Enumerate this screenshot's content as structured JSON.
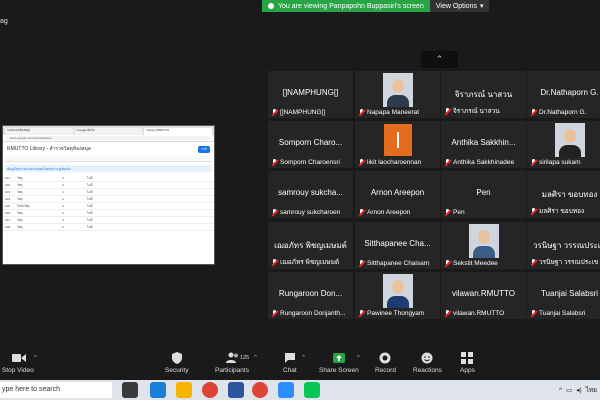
{
  "banner": {
    "viewing_text": "You are viewing Panpapohn Buppasiri's screen",
    "view_options_label": "View Options"
  },
  "top_left_text": "ag",
  "shared_screen": {
    "tabs": [
      "ระบบงานห้องสมุด",
      "Google ฟอร์ม",
      "Library RMUTTO"
    ],
    "url": "docs.google.com/spreadsheets",
    "doc_title": "RMUTTO Library - สำรวจวัสดุห้องสมุด",
    "share_label": "แชร์",
    "notice": "ข้อมูลไฟล์บางส่วนอาจแสดงไม่ครบถ้วน ดูเพิ่มเติม",
    "rows": [
      [
        "101",
        "วัสดุ",
        "4",
        "ไม่มี"
      ],
      [
        "102",
        "วัสดุ",
        "4",
        "ไม่มี"
      ],
      [
        "103",
        "วัสดุ",
        "4",
        "ไม่มี"
      ],
      [
        "104",
        "วัสดุ",
        "4",
        "ไม่มี"
      ],
      [
        "105",
        "ใบรับวัสดุ",
        "4",
        "ไม่มี"
      ],
      [
        "106",
        "วัสดุ",
        "4",
        "ไม่มี"
      ],
      [
        "107",
        "วัสดุ",
        "4",
        "ไม่มี"
      ],
      [
        "108",
        "วัสดุ",
        "4",
        "ไม่มี"
      ]
    ]
  },
  "participants": [
    {
      "big": "[]NAMPHUNG[]",
      "name": "[]NAMPHUNG[]",
      "kind": "name"
    },
    {
      "big": "",
      "name": "Napapa Maneerat",
      "kind": "photo",
      "body": "#2e3b4f"
    },
    {
      "big": "จิราภรณ์ นาสวน",
      "name": "จิราภรณ์ นาสวน",
      "kind": "name"
    },
    {
      "big": "Dr.Nathaporn G.",
      "name": "Dr.Nathaporn G.",
      "kind": "name"
    },
    {
      "big": "Somporn  Charo...",
      "name": "Somporn Charoensri",
      "kind": "name"
    },
    {
      "big": "",
      "name": "likit laocharoennan",
      "kind": "orange"
    },
    {
      "big": "Anthika  Sakkhin...",
      "name": "Anthika Sakkhinadee",
      "kind": "name"
    },
    {
      "big": "",
      "name": "sirilapa sukam",
      "kind": "photo",
      "body": "#222"
    },
    {
      "big": "samrouy  sukcha...",
      "name": "samrouy sukcharoen",
      "kind": "name"
    },
    {
      "big": "Arnon  Areepon",
      "name": "Arnon Areepon",
      "kind": "name"
    },
    {
      "big": "Pen",
      "name": "Pen",
      "kind": "name"
    },
    {
      "big": "มลศิรา  ขอบทอง",
      "name": "มลศิรา ขอบทอง",
      "kind": "name"
    },
    {
      "big": "เฌอภัทร  พิชญเมษมต์",
      "name": "เฌอภัทร พิชญเมษมต์",
      "kind": "name"
    },
    {
      "big": "Sitthapanee  Cha...",
      "name": "Sitthapanee Chaisarn",
      "kind": "name"
    },
    {
      "big": "",
      "name": "Sekstit Meedee",
      "kind": "photo",
      "body": "#3a5c85"
    },
    {
      "big": "วรนิษฐา  วรรณประเข",
      "name": "วรนิษฐา วรรณประเข",
      "kind": "name"
    },
    {
      "big": "Rungaroon  Don...",
      "name": "Rungaroon Donjanth...",
      "kind": "name"
    },
    {
      "big": "",
      "name": "Pawinee Thongyam",
      "kind": "photo",
      "body": "#1f3b73"
    },
    {
      "big": "vilawan.RMUTTO",
      "name": "vilawan.RMUTTO",
      "kind": "name"
    },
    {
      "big": "Tuanjai  Salabsri",
      "name": "Tuanjai Salabsri",
      "kind": "name"
    }
  ],
  "controls": {
    "stop_video": "Stop Video",
    "security": "Security",
    "participants": "Participants",
    "participants_count": "125",
    "chat": "Chat",
    "share_screen": "Share Screen",
    "record": "Record",
    "reactions": "Reactions",
    "apps": "Apps"
  },
  "taskbar": {
    "search_text": "ype here to search",
    "tray_lang": "ไทย"
  },
  "colors": {
    "banner_green": "#27a545",
    "share_green": "#27a545",
    "tile_bg": "#252525",
    "muted_red": "#e02828"
  }
}
